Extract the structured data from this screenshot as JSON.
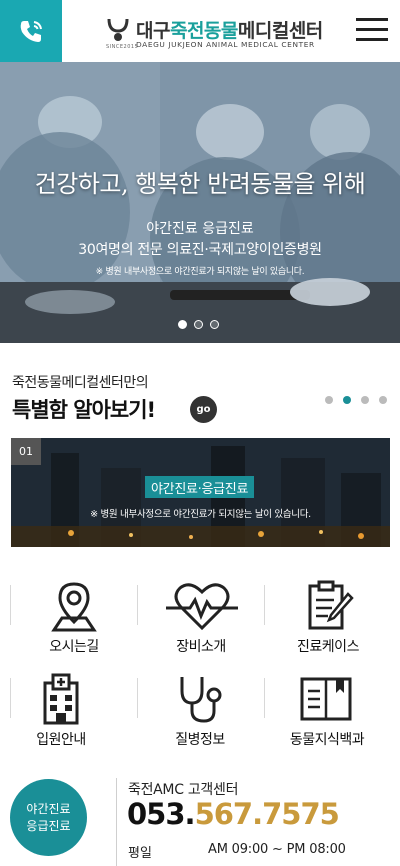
{
  "header": {
    "call_icon": "phone-icon",
    "logo_ko_prefix": "대구",
    "logo_ko_green": "죽전동물",
    "logo_ko_suffix": "메디컬센터",
    "logo_en": "DAEGU JUKJEON ANIMAL MEDICAL CENTER",
    "logo_since": "SINCE2015",
    "menu_icon": "hamburger-icon",
    "accent": "#1aa8b2"
  },
  "hero": {
    "title": "건강하고, 행복한 반려동물을 위해",
    "line1": "야간진료 응급진료",
    "line2": "30여명의 전문 의료진·국제고양이인증병원",
    "note": "※ 병원 내부사정으로 야간진료가 되지않는 날이 있습니다.",
    "slides": 3,
    "active_slide": 1
  },
  "special": {
    "subtitle": "죽전동물메디컬센터만의",
    "title": "특별함 알아보기!",
    "go_label": "go",
    "slides": 4,
    "active_slide": 2,
    "banner": {
      "number": "01",
      "tag": "야간진료·응급진료",
      "note": "※ 병원 내부사정으로 야간진료가 되지않는 날이 있습니다."
    }
  },
  "menu_grid": [
    {
      "label": "오시는길",
      "icon": "map-pin-icon"
    },
    {
      "label": "장비소개",
      "icon": "heartbeat-icon"
    },
    {
      "label": "진료케이스",
      "icon": "clipboard-icon"
    },
    {
      "label": "입원안내",
      "icon": "hospital-icon"
    },
    {
      "label": "질병정보",
      "icon": "stethoscope-icon"
    },
    {
      "label": "동물지식백과",
      "icon": "book-icon"
    }
  ],
  "contact": {
    "badge_line1": "야간진료",
    "badge_line2": "응급진료",
    "center_title": "죽전AMC 고객센터",
    "phone_prefix": "053.",
    "phone_rest": "567.7575",
    "day_label": "평일",
    "hours": "AM 09:00 ~ PM 08:00",
    "phone_color": "#c99a3c"
  }
}
